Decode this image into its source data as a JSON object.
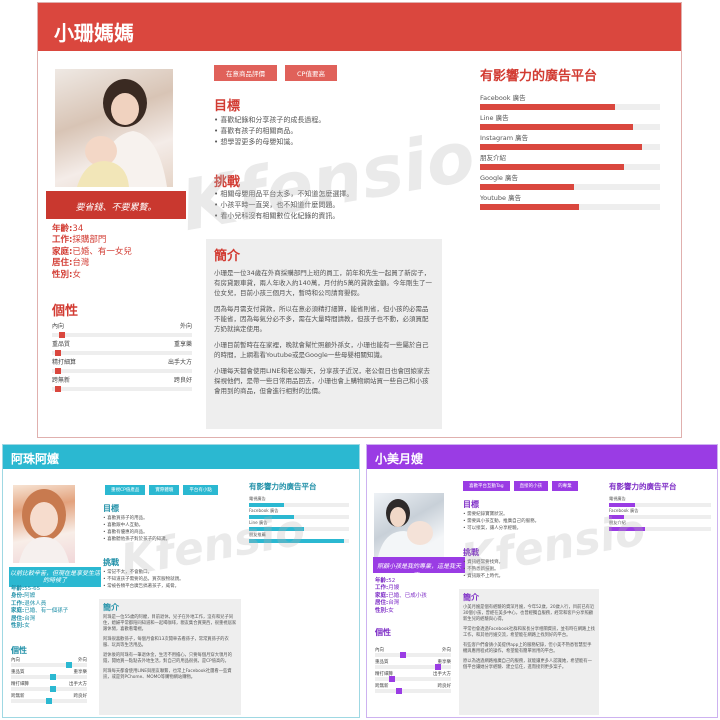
{
  "personas": [
    {
      "name": "小珊媽媽",
      "quote": "要省錢、不要累贅。",
      "tags": [
        "在意商品評價",
        "CP值要高"
      ],
      "demographics": [
        {
          "k": "年齡:",
          "v": "34"
        },
        {
          "k": "工作:",
          "v": "採購部門"
        },
        {
          "k": "家庭:",
          "v": "已婚、有一女兒"
        },
        {
          "k": "居住:",
          "v": "台灣"
        },
        {
          "k": "性別:",
          "v": "女"
        }
      ],
      "personality_title": "個性",
      "personality": [
        {
          "left": "內向",
          "right": "外向",
          "value": 0.05
        },
        {
          "left": "重品質",
          "right": "重享樂",
          "value": 0.02
        },
        {
          "left": "精打細算",
          "right": "出手大方",
          "value": 0.02
        },
        {
          "left": "跨無新",
          "right": "跨良好",
          "value": 0.02
        }
      ],
      "goals_title": "目標",
      "goals": [
        "喜歡紀錄和分享孩子的成長過程。",
        "喜歡有孩子的相關商品。",
        "想學習更多的母嬰知識。"
      ],
      "challenges_title": "挑戰",
      "challenges": [
        "相關母嬰用品平台太多，不知道怎麼選擇。",
        "小孩平時一直哭，也不知道什麼問題。",
        "看小兒科沒有相關數位化紀錄的資訊。"
      ],
      "intro_title": "簡介",
      "intro": [
        "小珊是一位34歲在外商採購部門上班的員工，前年和先生一起買了新房子，有房貸跟車貸，兩人年收入約140萬，月付約5萬的貸款金額。今年剛生了一位女兒，目前小孩三個月大，暫時和公司請育嬰假。",
        "因為每月需支付貸款，所以在意必須精打細算，能省則省，但小孩的必需品不能省，因為每氣分必不多，需在大量時間請教，但孩子也不動，必須買配方奶就搞定使用。",
        "小珊目前暫時在在家裡，晚就會幫忙照顧外孫女，小珊也能有一些屬於自己的時間，上網看看Youtube或是Google一些母嬰相關知識。",
        "小珊每天都會使用LINE和老公聯天，分享孩子近況，老公假日也會回娘家去探視他們，是帶一些日常用品回去，小珊也會上購物網站買一些自己和小孩會用到的商品，但會進行相對的比價。"
      ],
      "ads_title": "有影響力的廣告平台",
      "ads": [
        {
          "label": "Facebook 廣告",
          "value": 0.75
        },
        {
          "label": "Line 廣告",
          "value": 0.85
        },
        {
          "label": "Instagram 廣告",
          "value": 0.9
        },
        {
          "label": "朋友介紹",
          "value": 0.8
        },
        {
          "label": "Google 廣告",
          "value": 0.52
        },
        {
          "label": "Youtube 廣告",
          "value": 0.55
        }
      ],
      "colors": {
        "accent": "#da473e"
      }
    },
    {
      "name": "阿珠阿嬤",
      "quote": "以前比較辛苦，但現在是享受生活的時候了",
      "tags": [
        "重視CP值產品",
        "實際體驗",
        "平台有小點"
      ],
      "demographics": [
        {
          "k": "年齡:",
          "v": "55-65"
        },
        {
          "k": "身份:",
          "v": "阿嬤"
        },
        {
          "k": "工作:",
          "v": "退休人員"
        },
        {
          "k": "家庭:",
          "v": "已婚、有一個孫子"
        },
        {
          "k": "居住:",
          "v": "台灣"
        },
        {
          "k": "性別:",
          "v": "女"
        }
      ],
      "personality_title": "個性",
      "personality": [
        {
          "left": "內向",
          "right": "外向",
          "value": 0.78
        },
        {
          "left": "重品質",
          "right": "重享樂",
          "value": 0.55
        },
        {
          "left": "精打細算",
          "right": "出手大方",
          "value": 0.55
        },
        {
          "left": "跨無新",
          "right": "跨良好",
          "value": 0.5
        }
      ],
      "goals_title": "目標",
      "goals": [
        "喜歡買孫子的用品。",
        "喜歡跟中人互動。",
        "喜歡有優惠的商品。",
        "喜歡聽他孫子對於孩子的知識。"
      ],
      "challenges_title": "挑戰",
      "challenges": [
        "常記不太，不會動口。",
        "不知道孩子需要的品，買衣服物就親。",
        "常被各類平台廣告搞著孩子，威脅。"
      ],
      "intro_title": "簡介",
      "intro": [
        "阿珠是一位55歲的阿嬤，目前退休，兒子在外地工作，沒有和兒子同住，媳婦平常都陪同知道和一起喝咖啡，親友集合買東西，很重視居家跟休閒，喜歡看電視。",
        "阿珠很喜歡孫子，每個月會和13次開車去看孫子，常常買孫子的衣服、玩具等生活用品。",
        "退休後的阿珠有一筆退休金，生活不用擔心，只要每個月穿大領月的錢，開始買一點點去外地生活，對自己的用品很挑，是CP值高的。",
        "阿珠每天都會使用LINE與朋友聯繫，也常上Facebook社團看一些資訊，或是到PChome、MOMO等購物網站購物。"
      ],
      "ads_title": "有影響力的廣告平台",
      "ads": [
        {
          "label": "電視廣告",
          "value": 0.35
        },
        {
          "label": "Facebook 廣告",
          "value": 0.45
        },
        {
          "label": "Line 廣告",
          "value": 0.55
        },
        {
          "label": "朋友推薦",
          "value": 0.95
        }
      ],
      "colors": {
        "accent": "#2bb8d1"
      }
    },
    {
      "name": "小美月嫂",
      "quote": "照顧小孩是我的專業，這是我天事。",
      "tags": [
        "喜歡平台互動Tag",
        "直接的小孩",
        "的專業"
      ],
      "demographics": [
        {
          "k": "年齡:",
          "v": "52"
        },
        {
          "k": "工作:",
          "v": "月嫂"
        },
        {
          "k": "家庭:",
          "v": "已婚、已成小孩"
        },
        {
          "k": "居住:",
          "v": "台灣"
        },
        {
          "k": "性別:",
          "v": "女"
        }
      ],
      "personality_title": "個性",
      "personality": [
        {
          "left": "內向",
          "right": "外向",
          "value": 0.35
        },
        {
          "left": "重品質",
          "right": "重享樂",
          "value": 0.85
        },
        {
          "left": "精打細算",
          "right": "出手大方",
          "value": 0.2
        },
        {
          "left": "跨無新",
          "right": "跨良好",
          "value": 0.3
        }
      ],
      "goals_title": "目標",
      "goals": [
        "需要紀錄寶寶狀況。",
        "需要與小孩互動，推廣自己的服務。",
        "可以接案，讓人分享經驗。"
      ],
      "challenges_title": "挑戰",
      "challenges": [
        "資訊經常要找齊。",
        "不熟悉新技術。",
        "資訊跟不上時代。"
      ],
      "intro_title": "簡介",
      "intro": [
        "小美月嫂是個有經驗的資深月嫂，今年52歲，20歲入行，目前已有近30個小孩，曾經在美多中心，也曾經獨自服務，經常和客戶分享照顧新生兒的經驗與心得。",
        "平常也會透過Facebook社群和家長分享相關資訊，並有時在網路上找工作，和其他月嫂交流，希望能在網路上找到好的平台。",
        "有些客戶們會請小美提供app上的服務紀錄，但小美不熟悉智慧型手機與應用程式的操作，希望能有簡單易用的平台。",
        "原以為透過網路推廣自己的服務，就能讓更多人認識她，希望能有一個平台讓她分享經驗、建立信任，進而接到更多案子。"
      ],
      "ads_title": "有影響力的廣告平台",
      "ads": [
        {
          "label": "電視廣告",
          "value": 0.25
        },
        {
          "label": "Facebook 廣告",
          "value": 0.15
        },
        {
          "label": "朋友介紹",
          "value": 0.35
        }
      ],
      "colors": {
        "accent": "#9a3ce4"
      }
    }
  ]
}
